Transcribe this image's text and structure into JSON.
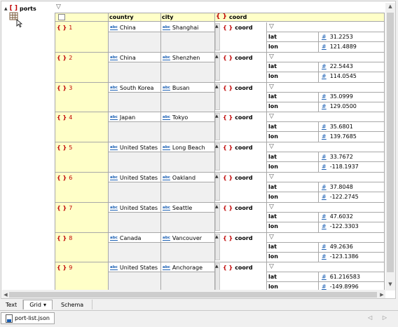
{
  "root": {
    "bracket": "[ ]",
    "name": "ports"
  },
  "headers": {
    "country": "country",
    "city": "city",
    "coord_brace": "{ }",
    "coord": "coord"
  },
  "icons": {
    "string_type": "abc",
    "number_type": "#",
    "object_brace": "{ }",
    "collapse": "▽",
    "expand_up": "▲"
  },
  "rows": [
    {
      "index": "1",
      "country": "China",
      "city": "Shanghai",
      "coord_label": "coord",
      "lat_key": "lat",
      "lat": "31.2253",
      "lon_key": "lon",
      "lon": "121.4889"
    },
    {
      "index": "2",
      "country": "China",
      "city": "Shenzhen",
      "coord_label": "coord",
      "lat_key": "lat",
      "lat": "22.5443",
      "lon_key": "lon",
      "lon": "114.0545"
    },
    {
      "index": "3",
      "country": "South Korea",
      "city": "Busan",
      "coord_label": "coord",
      "lat_key": "lat",
      "lat": "35.0999",
      "lon_key": "lon",
      "lon": "129.0500"
    },
    {
      "index": "4",
      "country": "Japan",
      "city": "Tokyo",
      "coord_label": "coord",
      "lat_key": "lat",
      "lat": "35.6801",
      "lon_key": "lon",
      "lon": "139.7685"
    },
    {
      "index": "5",
      "country": "United States",
      "city": "Long Beach",
      "coord_label": "coord",
      "lat_key": "lat",
      "lat": "33.7672",
      "lon_key": "lon",
      "lon": "-118.1937"
    },
    {
      "index": "6",
      "country": "United States",
      "city": "Oakland",
      "coord_label": "coord",
      "lat_key": "lat",
      "lat": "37.8048",
      "lon_key": "lon",
      "lon": "-122.2745"
    },
    {
      "index": "7",
      "country": "United States",
      "city": "Seattle",
      "coord_label": "coord",
      "lat_key": "lat",
      "lat": "47.6032",
      "lon_key": "lon",
      "lon": "-122.3303"
    },
    {
      "index": "8",
      "country": "Canada",
      "city": "Vancouver",
      "coord_label": "coord",
      "lat_key": "lat",
      "lat": "49.2636",
      "lon_key": "lon",
      "lon": "-123.1386"
    },
    {
      "index": "9",
      "country": "United States",
      "city": "Anchorage",
      "coord_label": "coord",
      "lat_key": "lat",
      "lat": "61.216583",
      "lon_key": "lon",
      "lon": "-149.8996"
    }
  ],
  "view_tabs": {
    "text": "Text",
    "grid": "Grid",
    "grid_dropdown": "▾",
    "schema": "Schema"
  },
  "file": {
    "name": "port-list.json",
    "nav": "◁ ▷"
  },
  "colors": {
    "header_bg": "#ffffc8",
    "object_brace": "#c00000",
    "type_icon": "#1a5fb4",
    "grid_line": "#a8a8a8"
  }
}
